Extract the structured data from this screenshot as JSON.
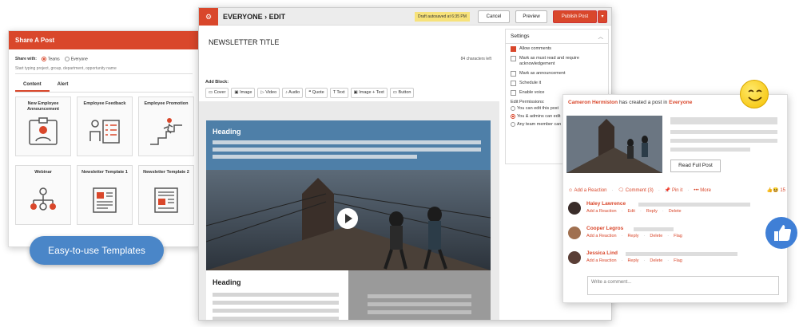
{
  "share": {
    "title": "Share A Post",
    "share_with_label": "Share with:",
    "option_teams": "Teams",
    "option_everyone": "Everyone",
    "hint": "Start typing project, group, department, opportunity name",
    "tabs": [
      {
        "label": "Content"
      },
      {
        "label": "Alert"
      }
    ],
    "templates": [
      {
        "label": "New Employee Announcement",
        "icon": "id-badge-icon"
      },
      {
        "label": "Employee Feedback",
        "icon": "feedback-checklist-icon"
      },
      {
        "label": "Employee Promotion",
        "icon": "stairs-promotion-icon"
      },
      {
        "label": "Webinar",
        "icon": "network-people-icon"
      },
      {
        "label": "Newsletter Template 1",
        "icon": "newspaper-icon"
      },
      {
        "label": "Newsletter Template 2",
        "icon": "newspaper-icon"
      }
    ]
  },
  "pill_label": "Easy-to-use Templates",
  "editor": {
    "breadcrumb": "EVERYONE › EDIT",
    "draft_status": "Draft autosaved at 6:35 PM",
    "cancel_label": "Cancel",
    "preview_label": "Preview",
    "publish_label": "Publish Post",
    "newsletter_title": "NEWSLETTER TITLE",
    "chars_left": "84 characters left",
    "add_block_label": "Add Block:",
    "blocks": [
      "Cover",
      "Image",
      "Video",
      "Audio",
      "Quote",
      "Text",
      "Image + Text",
      "Button"
    ],
    "preview_heading_1": "Heading",
    "preview_heading_2": "Heading"
  },
  "settings": {
    "title": "Settings",
    "options": [
      {
        "label": "Allow comments",
        "checked": true
      },
      {
        "label": "Mark as must read and require acknowledgement",
        "checked": false
      },
      {
        "label": "Mark as announcement",
        "checked": false
      },
      {
        "label": "Schedule it",
        "checked": false
      },
      {
        "label": "Enable voice",
        "checked": false
      }
    ],
    "edit_permissions_label": "Edit Permissions:",
    "permissions": [
      {
        "label": "You can edit this post",
        "selected": false
      },
      {
        "label": "You & admins can edit",
        "selected": true
      },
      {
        "label": "Any team member can",
        "selected": false
      }
    ]
  },
  "feed": {
    "author": "Cameron Hermiston",
    "action_text": "has created a post in",
    "target": "Everyone",
    "read_full_label": "Read Full Post",
    "add_reaction_label": "Add a Reaction",
    "comment_label": "Comment (3)",
    "pin_label": "Pin it",
    "more_label": "More",
    "reaction_count": "15",
    "comments": [
      {
        "name": "Haley Lawrence",
        "actions": [
          "Add a Reaction",
          "Edit",
          "Reply",
          "Delete"
        ]
      },
      {
        "name": "Cooper Legros",
        "actions": [
          "Add a Reaction",
          "Reply",
          "Delete",
          "Flag"
        ]
      },
      {
        "name": "Jessica Lind",
        "actions": [
          "Add a Reaction",
          "Reply",
          "Delete",
          "Flag"
        ]
      }
    ],
    "write_placeholder": "Write a comment..."
  },
  "colors": {
    "accent": "#d9472b",
    "heading_blue": "#4e7fa8",
    "pill_blue": "#4a86c8"
  }
}
